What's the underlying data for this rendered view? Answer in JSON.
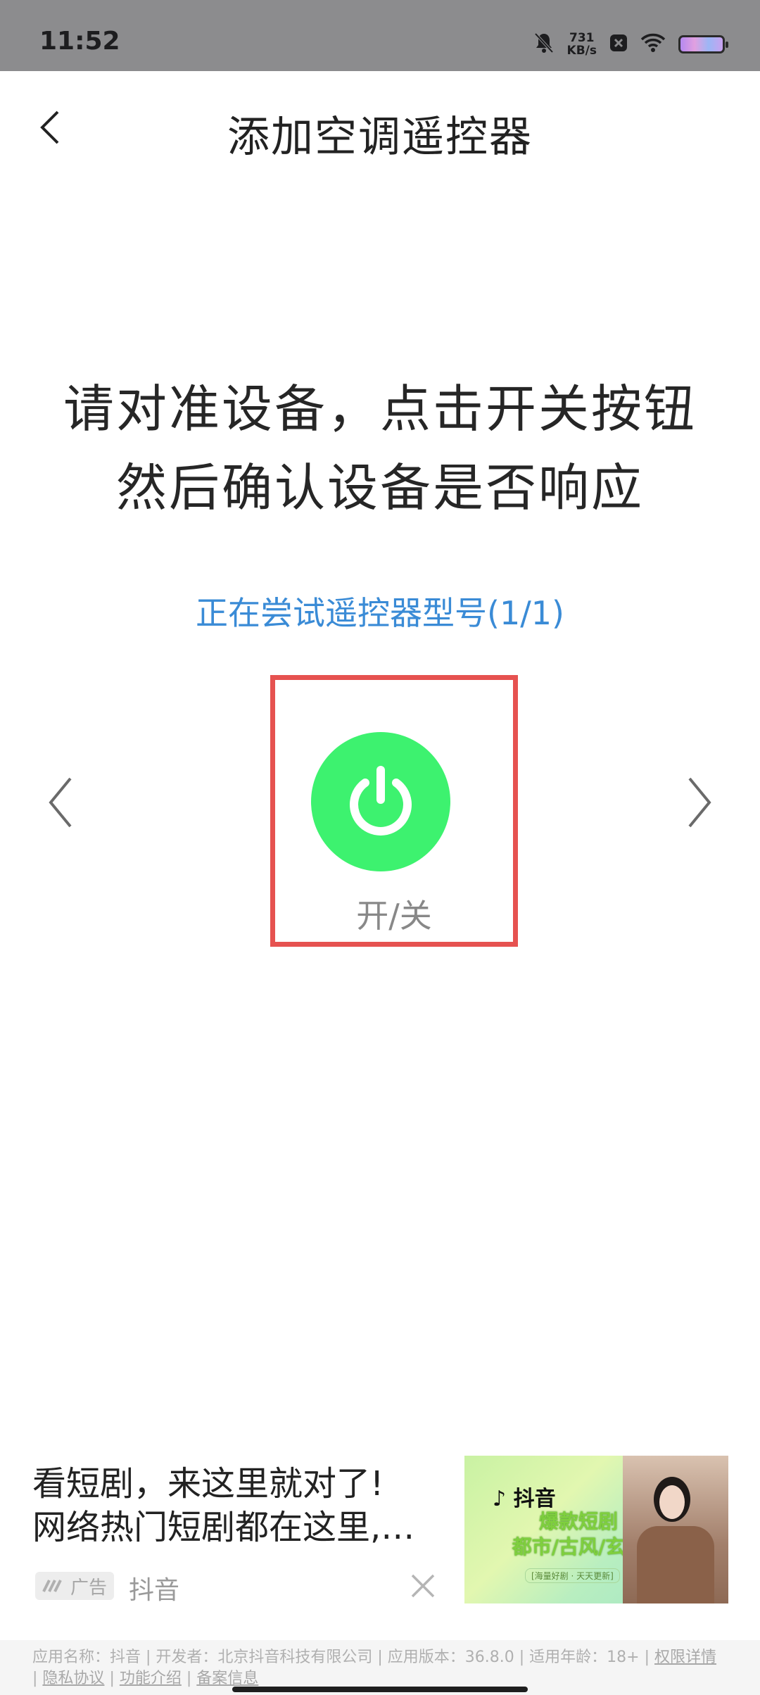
{
  "status_bar": {
    "time": "11:52",
    "net_speed_value": "731",
    "net_speed_unit": "KB/s"
  },
  "header": {
    "title": "添加空调遥控器"
  },
  "instruction": {
    "line1": "请对准设备，点击开关按钮",
    "line2": "然后确认设备是否响应"
  },
  "status_text": "正在尝试遥控器型号(1/1)",
  "power": {
    "label": "开/关",
    "button_color": "#3df26f",
    "highlight_color": "#e65250"
  },
  "ad": {
    "line1": "看短剧，来这里就对了!",
    "line2": "网络热门短剧都在这里,…",
    "badge": "广告",
    "source": "抖音",
    "image_logo": "抖音",
    "image_promo1": "爆款短剧",
    "image_promo2": "都市/古风/玄幻",
    "image_promo_sub": "[海量好剧 · 天天更新]"
  },
  "footer": {
    "info": "应用名称：抖音 | 开发者：北京抖音科技有限公司 | 应用版本：36.8.0 | 适用年龄：18+ |",
    "permissions": "权限详情",
    "privacy": "隐私协议",
    "features": "功能介绍",
    "filing": "备案信息",
    "sep": "|"
  },
  "accent_color": "#3a8bd6"
}
